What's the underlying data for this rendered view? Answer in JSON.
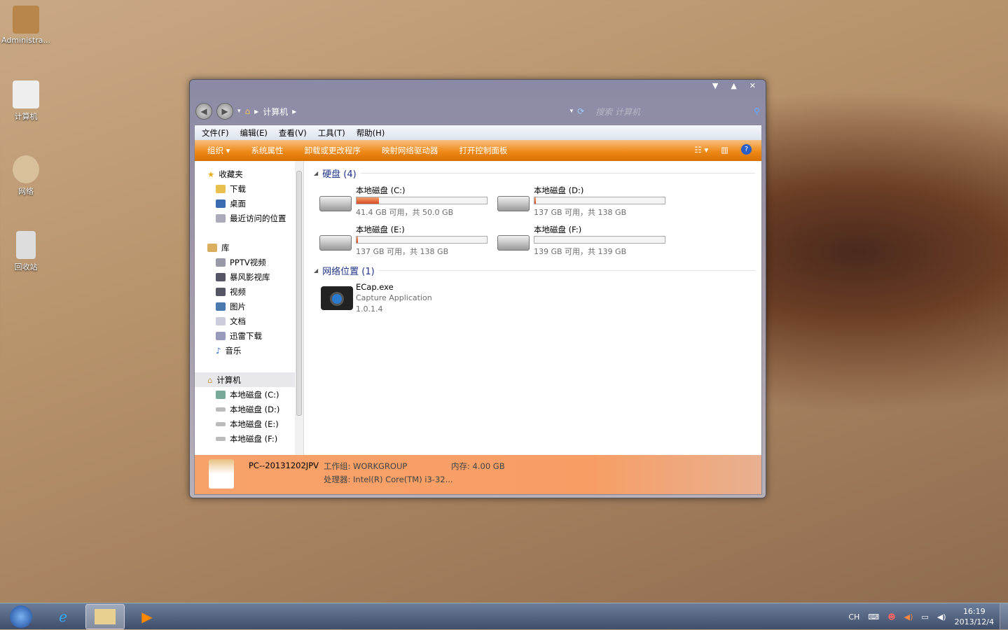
{
  "desktop": {
    "icons": [
      {
        "label": "Administra..."
      },
      {
        "label": "计算机"
      },
      {
        "label": "网络"
      },
      {
        "label": "回收站"
      }
    ]
  },
  "window": {
    "breadcrumb": [
      "计算机"
    ],
    "search_placeholder": "搜索 计算机",
    "menu": [
      "文件(F)",
      "编辑(E)",
      "查看(V)",
      "工具(T)",
      "帮助(H)"
    ],
    "commands": [
      "组织 ▾",
      "系统属性",
      "卸载或更改程序",
      "映射网络驱动器",
      "打开控制面板"
    ],
    "nav": {
      "favorites": {
        "label": "收藏夹",
        "items": [
          "下载",
          "桌面",
          "最近访问的位置"
        ]
      },
      "libraries": {
        "label": "库",
        "items": [
          "PPTV视频",
          "暴风影视库",
          "视频",
          "图片",
          "文档",
          "迅雷下载",
          "音乐"
        ]
      },
      "computer": {
        "label": "计算机",
        "items": [
          "本地磁盘 (C:)",
          "本地磁盘 (D:)",
          "本地磁盘 (E:)",
          "本地磁盘 (F:)"
        ]
      }
    },
    "groups": {
      "hdd": "硬盘 (4)",
      "network": "网络位置 (1)"
    },
    "drives": [
      {
        "name": "本地磁盘 (C:)",
        "free": "41.4 GB 可用，共 50.0 GB",
        "used_fraction": 0.17
      },
      {
        "name": "本地磁盘 (D:)",
        "free": "137 GB 可用，共 138 GB",
        "used_fraction": 0.01
      },
      {
        "name": "本地磁盘 (E:)",
        "free": "137 GB 可用，共 138 GB",
        "used_fraction": 0.01
      },
      {
        "name": "本地磁盘 (F:)",
        "free": "139 GB 可用，共 139 GB",
        "used_fraction": 0.0
      }
    ],
    "network_item": {
      "name": "ECap.exe",
      "desc": "Capture Application",
      "version": "1.0.1.4"
    },
    "details": {
      "pc": "PC--20131202JPV",
      "workgroup": "工作组: WORKGROUP",
      "memory": "内存: 4.00 GB",
      "cpu": "处理器: Intel(R) Core(TM) i3-32..."
    }
  },
  "taskbar": {
    "lang": "CH",
    "time": "16:19",
    "date": "2013/12/4"
  }
}
